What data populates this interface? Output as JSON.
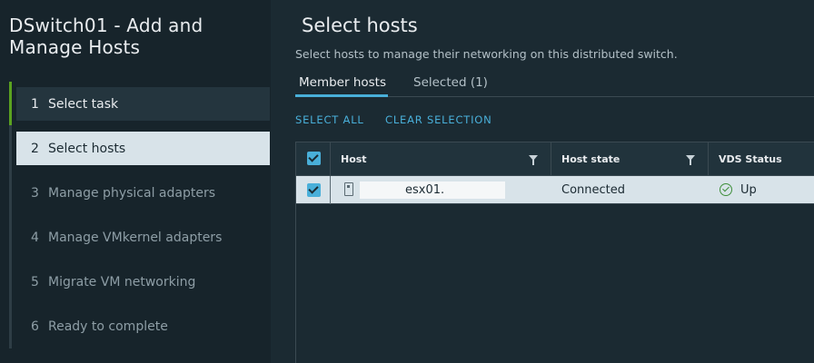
{
  "wizard": {
    "title": "DSwitch01 - Add and Manage Hosts",
    "steps": [
      {
        "number": "1",
        "label": "Select task",
        "state": "done"
      },
      {
        "number": "2",
        "label": "Select hosts",
        "state": "current"
      },
      {
        "number": "3",
        "label": "Manage physical adapters",
        "state": "future"
      },
      {
        "number": "4",
        "label": "Manage VMkernel adapters",
        "state": "future"
      },
      {
        "number": "5",
        "label": "Migrate VM networking",
        "state": "future"
      },
      {
        "number": "6",
        "label": "Ready to complete",
        "state": "future"
      }
    ]
  },
  "page": {
    "title": "Select hosts",
    "subtitle": "Select hosts to manage their networking on this distributed switch."
  },
  "tabs": [
    {
      "label": "Member hosts",
      "active": true
    },
    {
      "label": "Selected (1)",
      "active": false
    }
  ],
  "actions": {
    "select_all": "SELECT ALL",
    "clear_selection": "CLEAR SELECTION"
  },
  "grid": {
    "columns": [
      "Host",
      "Host state",
      "VDS Status"
    ],
    "rows": [
      {
        "checked": true,
        "host": "esx01.",
        "host_state": "Connected",
        "vds_status": "Up"
      }
    ]
  },
  "colors": {
    "accent": "#49afd9",
    "done_step": "#5aa220",
    "status_ok": "#3e8e3a"
  },
  "icons": [
    "checkbox-icon",
    "filter-icon",
    "host-server-icon",
    "status-ok-icon"
  ]
}
